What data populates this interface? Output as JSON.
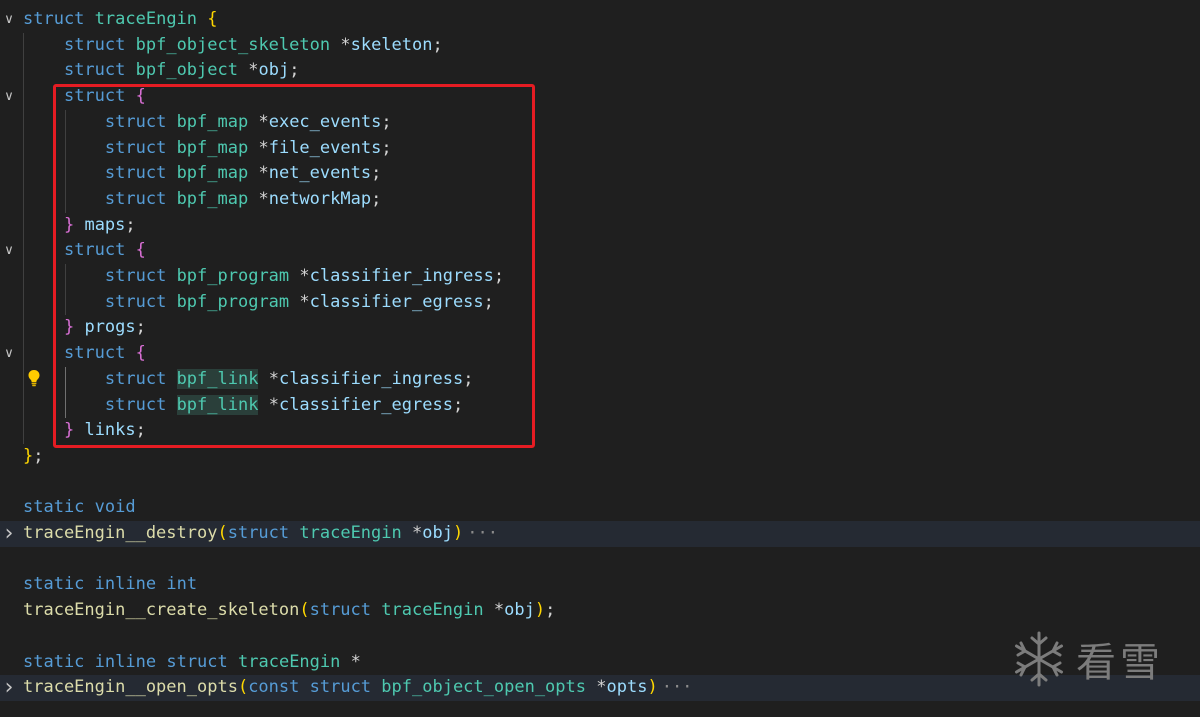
{
  "lines": [
    {
      "fold": "down",
      "tokens": [
        [
          "kw",
          "struct"
        ],
        [
          "pl",
          " "
        ],
        [
          "ty",
          "traceEngin"
        ],
        [
          "pl",
          " "
        ],
        [
          "b1",
          "{"
        ]
      ]
    },
    {
      "tokens": [
        [
          "pl",
          "    "
        ],
        [
          "kw",
          "struct"
        ],
        [
          "pl",
          " "
        ],
        [
          "ty",
          "bpf_object_skeleton"
        ],
        [
          "pl",
          " "
        ],
        [
          "op",
          "*"
        ],
        [
          "id",
          "skeleton"
        ],
        [
          "pl",
          ";"
        ]
      ]
    },
    {
      "tokens": [
        [
          "pl",
          "    "
        ],
        [
          "kw",
          "struct"
        ],
        [
          "pl",
          " "
        ],
        [
          "ty",
          "bpf_object"
        ],
        [
          "pl",
          " "
        ],
        [
          "op",
          "*"
        ],
        [
          "id",
          "obj"
        ],
        [
          "pl",
          ";"
        ]
      ]
    },
    {
      "fold": "down",
      "tokens": [
        [
          "pl",
          "    "
        ],
        [
          "kw",
          "struct"
        ],
        [
          "pl",
          " "
        ],
        [
          "b2",
          "{"
        ]
      ]
    },
    {
      "tokens": [
        [
          "pl",
          "        "
        ],
        [
          "kw",
          "struct"
        ],
        [
          "pl",
          " "
        ],
        [
          "ty",
          "bpf_map"
        ],
        [
          "pl",
          " "
        ],
        [
          "op",
          "*"
        ],
        [
          "id",
          "exec_events"
        ],
        [
          "pl",
          ";"
        ]
      ]
    },
    {
      "tokens": [
        [
          "pl",
          "        "
        ],
        [
          "kw",
          "struct"
        ],
        [
          "pl",
          " "
        ],
        [
          "ty",
          "bpf_map"
        ],
        [
          "pl",
          " "
        ],
        [
          "op",
          "*"
        ],
        [
          "id",
          "file_events"
        ],
        [
          "pl",
          ";"
        ]
      ]
    },
    {
      "tokens": [
        [
          "pl",
          "        "
        ],
        [
          "kw",
          "struct"
        ],
        [
          "pl",
          " "
        ],
        [
          "ty",
          "bpf_map"
        ],
        [
          "pl",
          " "
        ],
        [
          "op",
          "*"
        ],
        [
          "id",
          "net_events"
        ],
        [
          "pl",
          ";"
        ]
      ]
    },
    {
      "tokens": [
        [
          "pl",
          "        "
        ],
        [
          "kw",
          "struct"
        ],
        [
          "pl",
          " "
        ],
        [
          "ty",
          "bpf_map"
        ],
        [
          "pl",
          " "
        ],
        [
          "op",
          "*"
        ],
        [
          "id",
          "networkMap"
        ],
        [
          "pl",
          ";"
        ]
      ]
    },
    {
      "tokens": [
        [
          "pl",
          "    "
        ],
        [
          "b2",
          "}"
        ],
        [
          "pl",
          " "
        ],
        [
          "id",
          "maps"
        ],
        [
          "pl",
          ";"
        ]
      ]
    },
    {
      "fold": "down",
      "tokens": [
        [
          "pl",
          "    "
        ],
        [
          "kw",
          "struct"
        ],
        [
          "pl",
          " "
        ],
        [
          "b2",
          "{"
        ]
      ]
    },
    {
      "tokens": [
        [
          "pl",
          "        "
        ],
        [
          "kw",
          "struct"
        ],
        [
          "pl",
          " "
        ],
        [
          "ty",
          "bpf_program"
        ],
        [
          "pl",
          " "
        ],
        [
          "op",
          "*"
        ],
        [
          "id",
          "classifier_ingress"
        ],
        [
          "pl",
          ";"
        ]
      ]
    },
    {
      "tokens": [
        [
          "pl",
          "        "
        ],
        [
          "kw",
          "struct"
        ],
        [
          "pl",
          " "
        ],
        [
          "ty",
          "bpf_program"
        ],
        [
          "pl",
          " "
        ],
        [
          "op",
          "*"
        ],
        [
          "id",
          "classifier_egress"
        ],
        [
          "pl",
          ";"
        ]
      ]
    },
    {
      "tokens": [
        [
          "pl",
          "    "
        ],
        [
          "b2",
          "}"
        ],
        [
          "pl",
          " "
        ],
        [
          "id",
          "progs"
        ],
        [
          "pl",
          ";"
        ]
      ]
    },
    {
      "fold": "down",
      "tokens": [
        [
          "pl",
          "    "
        ],
        [
          "kw",
          "struct"
        ],
        [
          "pl",
          " "
        ],
        [
          "b2",
          "{"
        ]
      ]
    },
    {
      "tokens": [
        [
          "pl",
          "        "
        ],
        [
          "kw",
          "struct"
        ],
        [
          "pl",
          " "
        ],
        [
          "tyhl",
          "bpf_link"
        ],
        [
          "pl",
          " "
        ],
        [
          "op",
          "*"
        ],
        [
          "id",
          "classifier_ingress"
        ],
        [
          "pl",
          ";"
        ]
      ]
    },
    {
      "tokens": [
        [
          "pl",
          "        "
        ],
        [
          "kw",
          "struct"
        ],
        [
          "pl",
          " "
        ],
        [
          "tyhl",
          "bpf_link"
        ],
        [
          "pl",
          " "
        ],
        [
          "op",
          "*"
        ],
        [
          "id",
          "classifier_egress"
        ],
        [
          "pl",
          ";"
        ]
      ]
    },
    {
      "tokens": [
        [
          "pl",
          "    "
        ],
        [
          "b2",
          "}"
        ],
        [
          "pl",
          " "
        ],
        [
          "id",
          "links"
        ],
        [
          "pl",
          ";"
        ]
      ]
    },
    {
      "tokens": [
        [
          "b1",
          "}"
        ],
        [
          "pl",
          ";"
        ]
      ]
    },
    {
      "tokens": []
    },
    {
      "tokens": [
        [
          "kw",
          "static"
        ],
        [
          "pl",
          " "
        ],
        [
          "kw",
          "void"
        ]
      ]
    },
    {
      "fold": "right",
      "bg": true,
      "ellipsis": true,
      "tokens": [
        [
          "fn",
          "traceEngin__destroy"
        ],
        [
          "b1",
          "("
        ],
        [
          "kw",
          "struct"
        ],
        [
          "pl",
          " "
        ],
        [
          "ty",
          "traceEngin"
        ],
        [
          "pl",
          " "
        ],
        [
          "op",
          "*"
        ],
        [
          "id",
          "obj"
        ],
        [
          "b1",
          ")"
        ]
      ]
    },
    {
      "tokens": []
    },
    {
      "tokens": [
        [
          "kw",
          "static"
        ],
        [
          "pl",
          " "
        ],
        [
          "kw",
          "inline"
        ],
        [
          "pl",
          " "
        ],
        [
          "kw",
          "int"
        ]
      ]
    },
    {
      "tokens": [
        [
          "fn",
          "traceEngin__create_skeleton"
        ],
        [
          "b1",
          "("
        ],
        [
          "kw",
          "struct"
        ],
        [
          "pl",
          " "
        ],
        [
          "ty",
          "traceEngin"
        ],
        [
          "pl",
          " "
        ],
        [
          "op",
          "*"
        ],
        [
          "id",
          "obj"
        ],
        [
          "b1",
          ")"
        ],
        [
          "pl",
          ";"
        ]
      ]
    },
    {
      "tokens": []
    },
    {
      "tokens": [
        [
          "kw",
          "static"
        ],
        [
          "pl",
          " "
        ],
        [
          "kw",
          "inline"
        ],
        [
          "pl",
          " "
        ],
        [
          "kw",
          "struct"
        ],
        [
          "pl",
          " "
        ],
        [
          "ty",
          "traceEngin"
        ],
        [
          "pl",
          " "
        ],
        [
          "op",
          "*"
        ]
      ]
    },
    {
      "fold": "right",
      "bg": true,
      "ellipsis": true,
      "tokens": [
        [
          "fn",
          "traceEngin__open_opts"
        ],
        [
          "b1",
          "("
        ],
        [
          "kw",
          "const"
        ],
        [
          "pl",
          " "
        ],
        [
          "kw",
          "struct"
        ],
        [
          "pl",
          " "
        ],
        [
          "ty",
          "bpf_object_open_opts"
        ],
        [
          "pl",
          " "
        ],
        [
          "op",
          "*"
        ],
        [
          "id",
          "opts"
        ],
        [
          "b1",
          ")"
        ]
      ]
    }
  ],
  "ellipsis": "···",
  "watermark": {
    "text": "看雪",
    "icon": "snowflake-icon"
  },
  "lightbulb_icon": "lightbulb-icon",
  "colors": {
    "background": "#1f1f1f",
    "keyword": "#569cd6",
    "type": "#4ec9b0",
    "function": "#dcdcaa",
    "identifier": "#9cdcfe",
    "bracket1": "#ffd700",
    "bracket2": "#da70d6",
    "highlight_box": "#e51c23"
  }
}
